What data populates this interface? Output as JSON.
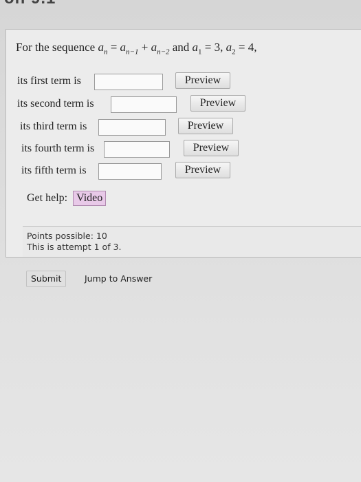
{
  "page": {
    "heading_fragment": "on 9.1"
  },
  "question": {
    "prefix": "For the sequence ",
    "formula": {
      "a": "a",
      "n": "n",
      "eq": " = ",
      "n_minus_1": "n−1",
      "plus": " + ",
      "n_minus_2": "n−2",
      "and": " and ",
      "one": "1",
      "eq3": " = 3, ",
      "two": "2",
      "eq4": " = 4,"
    }
  },
  "terms": [
    {
      "label": "its first term is",
      "value": "",
      "preview_label": "Preview"
    },
    {
      "label": "its second term is",
      "value": "",
      "preview_label": "Preview"
    },
    {
      "label": "its third term is",
      "value": "",
      "preview_label": "Preview"
    },
    {
      "label": "its fourth term is",
      "value": "",
      "preview_label": "Preview"
    },
    {
      "label": "its fifth term is",
      "value": "",
      "preview_label": "Preview"
    }
  ],
  "help": {
    "label": "Get help:",
    "video_label": "Video"
  },
  "info": {
    "points": "Points possible: 10",
    "attempt": "This is attempt 1 of 3."
  },
  "actions": {
    "submit_label": "Submit",
    "jump_label": "Jump to Answer"
  }
}
